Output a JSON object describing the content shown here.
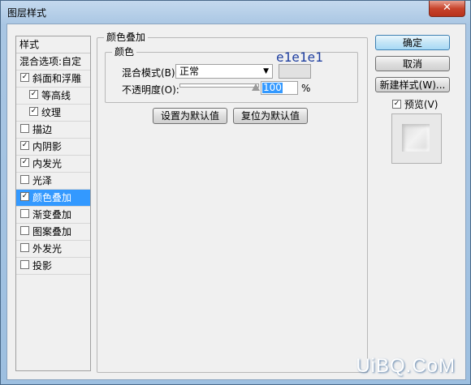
{
  "window": {
    "title": "图层样式",
    "close_glyph": "✕"
  },
  "style_list": {
    "header": "样式",
    "blend_options": "混合选项:自定",
    "items": [
      {
        "label": "斜面和浮雕",
        "checked": true,
        "sub": false,
        "selected": false
      },
      {
        "label": "等高线",
        "checked": true,
        "sub": true,
        "selected": false
      },
      {
        "label": "纹理",
        "checked": true,
        "sub": true,
        "selected": false
      },
      {
        "label": "描边",
        "checked": false,
        "sub": false,
        "selected": false
      },
      {
        "label": "内阴影",
        "checked": true,
        "sub": false,
        "selected": false
      },
      {
        "label": "内发光",
        "checked": true,
        "sub": false,
        "selected": false
      },
      {
        "label": "光泽",
        "checked": false,
        "sub": false,
        "selected": false
      },
      {
        "label": "颜色叠加",
        "checked": true,
        "sub": false,
        "selected": true
      },
      {
        "label": "渐变叠加",
        "checked": false,
        "sub": false,
        "selected": false
      },
      {
        "label": "图案叠加",
        "checked": false,
        "sub": false,
        "selected": false
      },
      {
        "label": "外发光",
        "checked": false,
        "sub": false,
        "selected": false
      },
      {
        "label": "投影",
        "checked": false,
        "sub": false,
        "selected": false
      }
    ]
  },
  "color_overlay": {
    "title": "颜色叠加",
    "group_title": "颜色",
    "blend_mode_label": "混合模式(B):",
    "blend_mode_value": "正常",
    "swatch_color": "#e1e1e1",
    "hex_annotation": "e1e1e1",
    "opacity_label": "不透明度(O):",
    "opacity_value": "100",
    "opacity_fraction": 1.0,
    "percent_sign": "%",
    "make_default_label": "设置为默认值",
    "reset_default_label": "复位为默认值"
  },
  "buttons": {
    "ok": "确定",
    "cancel": "取消",
    "new_style": "新建样式(W)...",
    "preview_label": "预览(V)",
    "preview_checked": true
  },
  "watermark": "UiBQ.CoM",
  "colors": {
    "selection": "#3399ff",
    "title_bg": "#a9c6e3"
  }
}
